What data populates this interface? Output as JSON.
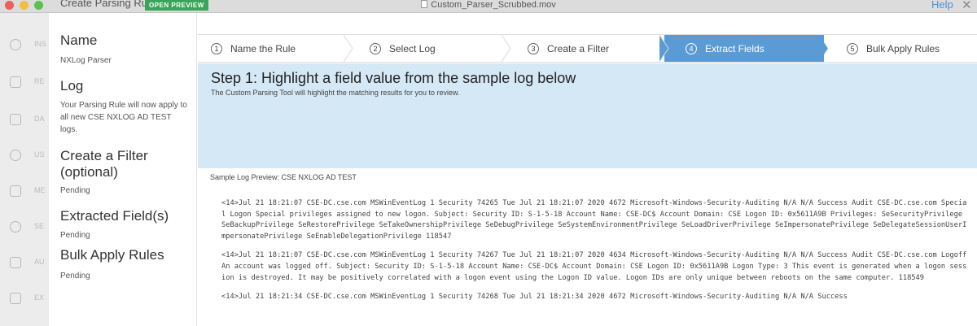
{
  "window": {
    "title": "Custom_Parser_Scrubbed.mov"
  },
  "header": {
    "page_title": "Create Parsing Rule",
    "badge": "OPEN PREVIEW",
    "help": "Help",
    "close": "✕"
  },
  "rail": {
    "items": [
      {
        "icon": "doc-icon",
        "label": "INS"
      },
      {
        "icon": "report-icon",
        "label": "RE"
      },
      {
        "icon": "grid-icon",
        "label": "DA"
      },
      {
        "icon": "user-icon",
        "label": "US"
      },
      {
        "icon": "monitor-icon",
        "label": "ME"
      },
      {
        "icon": "gear-icon",
        "label": "SE"
      },
      {
        "icon": "list-icon",
        "label": "AU"
      },
      {
        "icon": "export-icon",
        "label": "EX"
      }
    ]
  },
  "summary": {
    "name_heading": "Name",
    "name_value": "NXLog Parser",
    "log_heading": "Log",
    "log_text": "Your Parsing Rule will now apply to all new CSE NXLOG AD TEST logs.",
    "filter_heading": "Create a Filter (optional)",
    "filter_status": "Pending",
    "fields_heading": "Extracted Field(s)",
    "fields_status": "Pending",
    "bulk_heading": "Bulk Apply Rules",
    "bulk_status": "Pending"
  },
  "steps": [
    {
      "num": "1",
      "label": "Name the Rule",
      "active": false
    },
    {
      "num": "2",
      "label": "Select Log",
      "active": false
    },
    {
      "num": "3",
      "label": "Create a Filter",
      "active": false
    },
    {
      "num": "4",
      "label": "Extract Fields",
      "active": true
    },
    {
      "num": "5",
      "label": "Bulk Apply Rules",
      "active": false
    }
  ],
  "banner": {
    "title": "Step 1: Highlight a field value from the sample log below",
    "subtitle": "The Custom Parsing Tool will highlight the matching results for you to review."
  },
  "sample": {
    "label": "Sample Log Preview: CSE NXLOG AD TEST",
    "entries": [
      "<14>Jul 21 18:21:07 CSE-DC.cse.com MSWinEventLog 1 Security 74265 Tue Jul 21 18:21:07 2020 4672 Microsoft-Windows-Security-Auditing N/A N/A Success Audit CSE-DC.cse.com Special Logon Special privileges assigned to new logon. Subject: Security ID: S-1-5-18 Account Name: CSE-DC$ Account Domain: CSE Logon ID: 0x5611A9B Privileges: SeSecurityPrivilege SeBackupPrivilege SeRestorePrivilege SeTakeOwnershipPrivilege SeDebugPrivilege SeSystemEnvironmentPrivilege SeLoadDriverPrivilege SeImpersonatePrivilege SeDelegateSessionUserImpersonatePrivilege SeEnableDelegationPrivilege 118547",
      "<14>Jul 21 18:21:07 CSE-DC.cse.com MSWinEventLog 1 Security 74267 Tue Jul 21 18:21:07 2020 4634 Microsoft-Windows-Security-Auditing N/A N/A Success Audit CSE-DC.cse.com Logoff An account was logged off. Subject: Security ID: S-1-5-18 Account Name: CSE-DC$ Account Domain: CSE Logon ID: 0x5611A9B Logon Type: 3 This event is generated when a logon session is destroyed. It may be positively correlated with a logon event using the Logon ID value. Logon IDs are only unique between reboots on the same computer. 118549",
      "<14>Jul 21 18:21:34 CSE-DC.cse.com MSWinEventLog 1 Security 74268 Tue Jul 21 18:21:34 2020 4672 Microsoft-Windows-Security-Auditing N/A N/A Success"
    ]
  },
  "colors": {
    "active_step": "#5b9bd5",
    "banner_bg": "#d5e8f6",
    "badge_bg": "#3aa55a",
    "help_link": "#4a90d9"
  }
}
